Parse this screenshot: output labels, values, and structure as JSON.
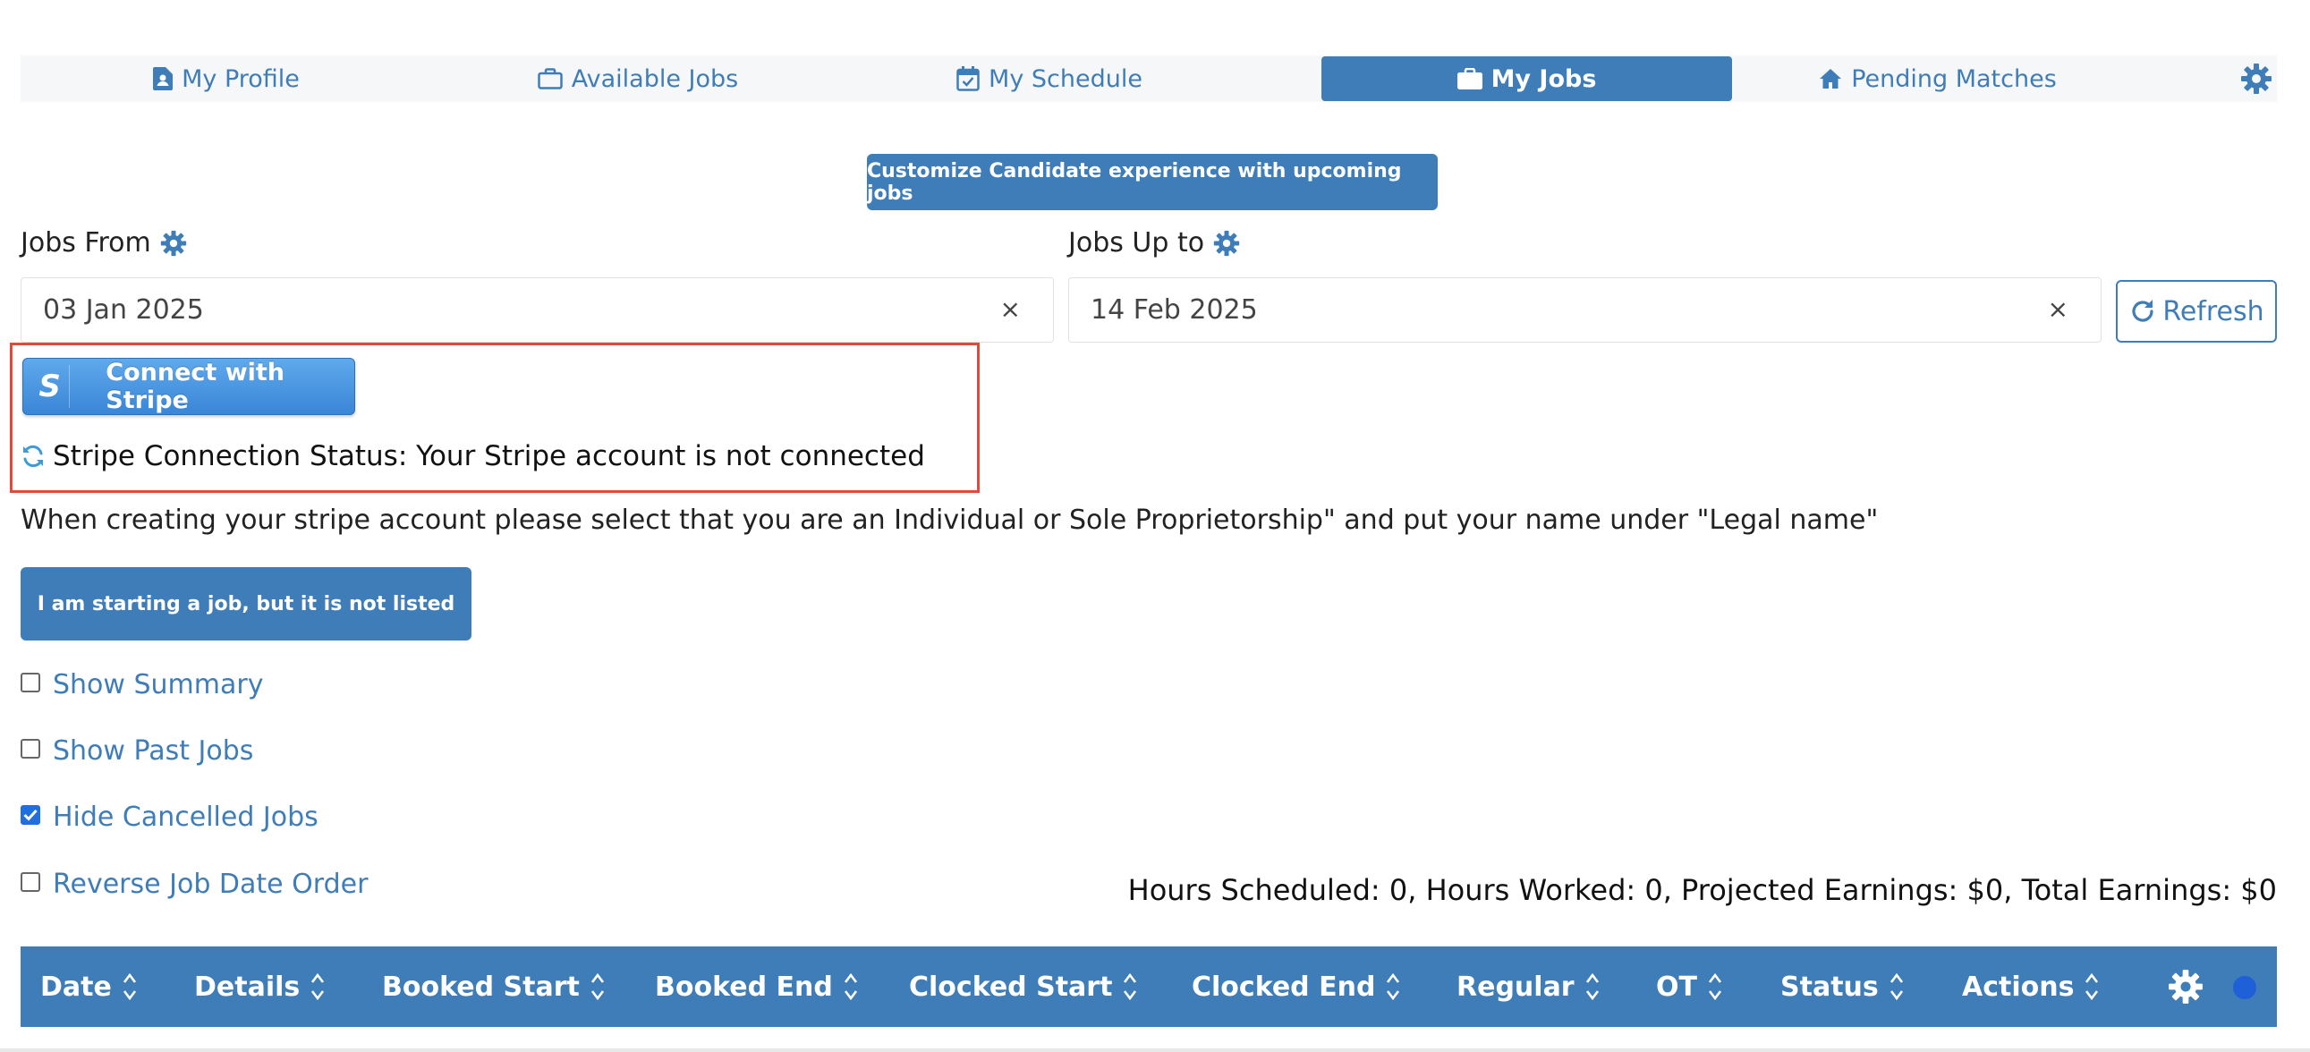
{
  "nav": {
    "items": [
      {
        "label": "My Profile",
        "icon": "profile-document-icon"
      },
      {
        "label": "Available Jobs",
        "icon": "briefcase-outline-icon"
      },
      {
        "label": "My Schedule",
        "icon": "calendar-check-icon"
      },
      {
        "label": "My Jobs",
        "icon": "briefcase-solid-icon",
        "active": true
      },
      {
        "label": "Pending Matches",
        "icon": "home-icon"
      }
    ],
    "settings_icon": "gear-icon"
  },
  "customize_button": "Customize Candidate experience with upcoming jobs",
  "filters": {
    "jobs_from_label": "Jobs From",
    "jobs_from_value": "03 Jan 2025",
    "jobs_up_to_label": "Jobs Up to",
    "jobs_up_to_value": "14 Feb 2025",
    "clear_symbol": "×",
    "refresh_label": "Refresh"
  },
  "stripe": {
    "button_badge": "S",
    "button_label": "Connect with Stripe",
    "status_text": "Stripe Connection Status: Your Stripe account is not connected"
  },
  "instruction": "When creating your stripe account please select that you are an Individual or Sole Proprietorship\" and put your name under \"Legal name\"",
  "start_job_button": "I am starting a job, but it is not listed",
  "options": [
    {
      "label": "Show Summary",
      "checked": false
    },
    {
      "label": "Show Past Jobs",
      "checked": false
    },
    {
      "label": "Hide Cancelled Jobs",
      "checked": true
    },
    {
      "label": "Reverse Job Date Order",
      "checked": false
    }
  ],
  "summary": "Hours Scheduled: 0, Hours Worked: 0, Projected Earnings: $0, Total Earnings: $0",
  "table": {
    "columns": [
      "Date",
      "Details",
      "Booked Start",
      "Booked End",
      "Clocked Start",
      "Clocked End",
      "Regular",
      "OT",
      "Status",
      "Actions"
    ]
  },
  "colors": {
    "primary": "#3f7db8",
    "highlight_border": "#e24a38",
    "checkbox_checked": "#1f6fde"
  }
}
